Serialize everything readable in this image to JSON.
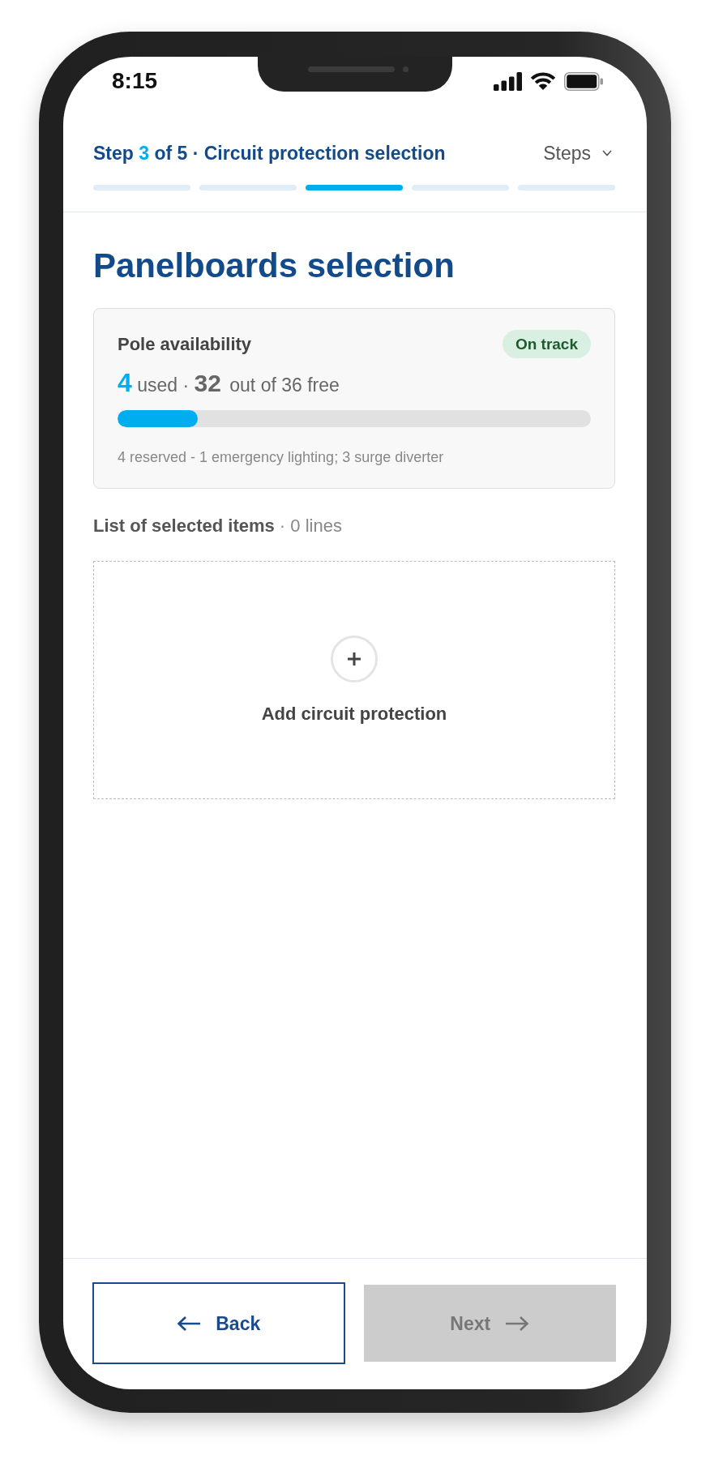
{
  "status_bar": {
    "time": "8:15"
  },
  "header": {
    "step_title": {
      "prefix": "Step",
      "current": "3",
      "suffix": "of 5 · Circuit protection selection"
    },
    "steps_menu": {
      "label": "Steps"
    },
    "segments": [
      {
        "current": false
      },
      {
        "current": false
      },
      {
        "current": true
      },
      {
        "current": false
      },
      {
        "current": false
      }
    ]
  },
  "page_title": "Panelboards selection",
  "card": {
    "title": "Pole availability",
    "badge": "On track",
    "used": "4",
    "used_label": "used",
    "separator": "·",
    "free": "32",
    "free_label": "out of 36 free",
    "level": 0.17,
    "note": "4 reserved - 1 emergency lighting; 3 surge diverter"
  },
  "list": {
    "title": "List of selected items",
    "count": "· 0 lines",
    "add_label": "Add circuit protection"
  },
  "buttons": [
    {
      "label": "Back",
      "kind": "secondary",
      "disabled": false
    },
    {
      "label": "Next",
      "kind": "primary",
      "disabled": true
    }
  ]
}
